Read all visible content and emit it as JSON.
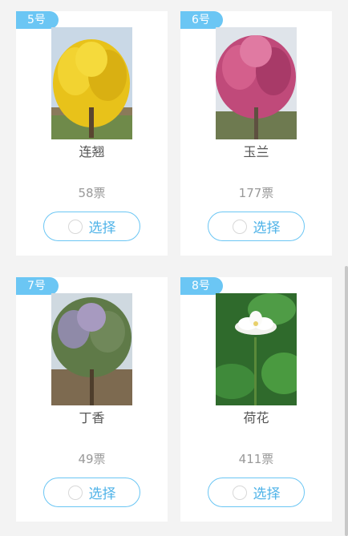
{
  "cards": [
    {
      "number": "5号",
      "name": "连翘",
      "votes": "58票",
      "button": "选择"
    },
    {
      "number": "6号",
      "name": "玉兰",
      "votes": "177票",
      "button": "选择"
    },
    {
      "number": "7号",
      "name": "丁香",
      "votes": "49票",
      "button": "选择"
    },
    {
      "number": "8号",
      "name": "荷花",
      "votes": "411票",
      "button": "选择"
    }
  ],
  "colors": {
    "accent": "#6bc6f4",
    "button_text": "#4fb3e8",
    "background": "#f3f3f3"
  }
}
